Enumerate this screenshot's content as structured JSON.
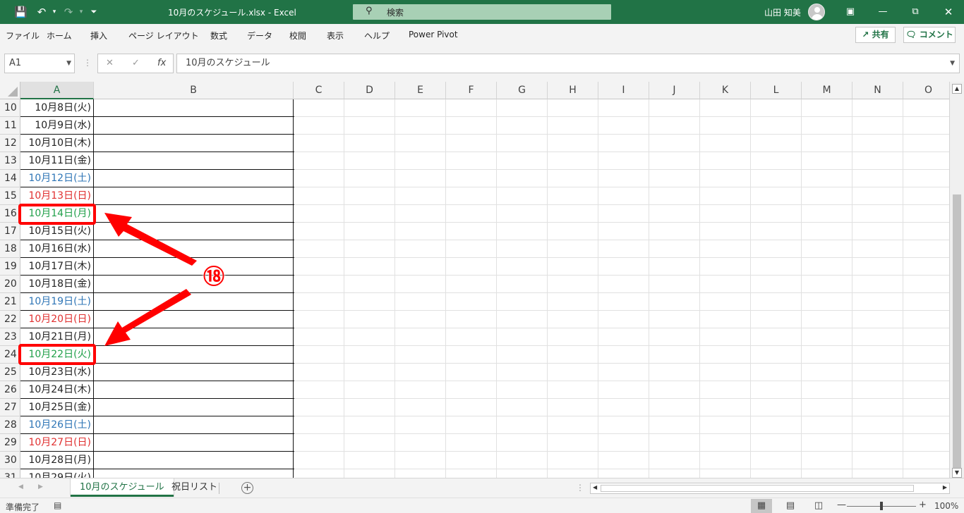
{
  "titlebar": {
    "title": "10月のスケジュール.xlsx  -  Excel",
    "search_placeholder": "検索",
    "user_name": "山田 知美",
    "background_color": "#217346"
  },
  "menu": {
    "items": [
      "ファイル",
      "ホーム",
      "挿入",
      "ページ レイアウト",
      "数式",
      "データ",
      "校閲",
      "表示",
      "ヘルプ",
      "Power Pivot"
    ],
    "share_label": "共有",
    "comment_label": "コメント"
  },
  "formula_bar": {
    "name_box": "A1",
    "fx": "fx",
    "content": "10月のスケジュール"
  },
  "columns": [
    "A",
    "B",
    "C",
    "D",
    "E",
    "F",
    "G",
    "H",
    "I",
    "J",
    "K",
    "L",
    "M",
    "N",
    "O"
  ],
  "rows": [
    {
      "num": "10",
      "a": "10月8日(火)",
      "style": "weekday"
    },
    {
      "num": "11",
      "a": "10月9日(水)",
      "style": "weekday"
    },
    {
      "num": "12",
      "a": "10月10日(木)",
      "style": "weekday"
    },
    {
      "num": "13",
      "a": "10月11日(金)",
      "style": "weekday"
    },
    {
      "num": "14",
      "a": "10月12日(土)",
      "style": "saturday"
    },
    {
      "num": "15",
      "a": "10月13日(日)",
      "style": "sunday"
    },
    {
      "num": "16",
      "a": "10月14日(月)",
      "style": "holiday"
    },
    {
      "num": "17",
      "a": "10月15日(火)",
      "style": "weekday"
    },
    {
      "num": "18",
      "a": "10月16日(水)",
      "style": "weekday"
    },
    {
      "num": "19",
      "a": "10月17日(木)",
      "style": "weekday"
    },
    {
      "num": "20",
      "a": "10月18日(金)",
      "style": "weekday"
    },
    {
      "num": "21",
      "a": "10月19日(土)",
      "style": "saturday"
    },
    {
      "num": "22",
      "a": "10月20日(日)",
      "style": "sunday"
    },
    {
      "num": "23",
      "a": "10月21日(月)",
      "style": "weekday"
    },
    {
      "num": "24",
      "a": "10月22日(火)",
      "style": "holiday"
    },
    {
      "num": "25",
      "a": "10月23日(水)",
      "style": "weekday"
    },
    {
      "num": "26",
      "a": "10月24日(木)",
      "style": "weekday"
    },
    {
      "num": "27",
      "a": "10月25日(金)",
      "style": "weekday"
    },
    {
      "num": "28",
      "a": "10月26日(土)",
      "style": "saturday"
    },
    {
      "num": "29",
      "a": "10月27日(日)",
      "style": "sunday"
    },
    {
      "num": "30",
      "a": "10月28日(月)",
      "style": "weekday"
    },
    {
      "num": "31",
      "a": "10月29日(火)",
      "style": "weekday"
    }
  ],
  "text_colors": {
    "weekday": "#222222",
    "saturday": "#2e75b6",
    "sunday": "#e03030",
    "holiday": "#21a04a"
  },
  "annotation": {
    "label": "⑱",
    "color": "#ff0000"
  },
  "sheets": {
    "tabs": [
      "10月のスケジュール",
      "祝日リスト"
    ],
    "active": "10月のスケジュール"
  },
  "status": {
    "text": "準備完了",
    "zoom": "100%",
    "zoom_level_percent": 100
  }
}
